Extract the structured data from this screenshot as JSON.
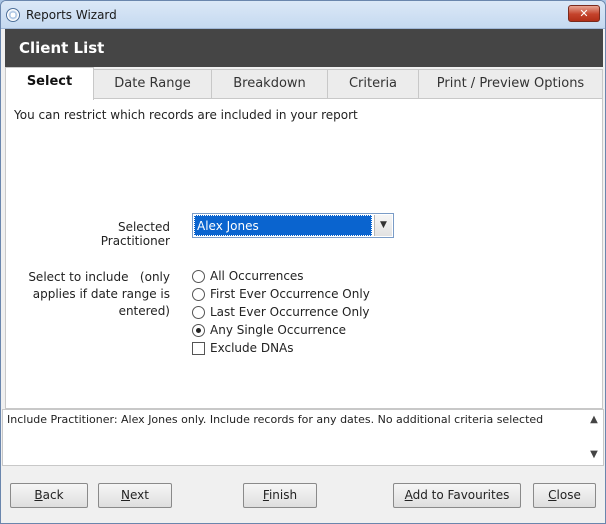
{
  "window": {
    "title": "Reports Wizard",
    "close_label": "✕"
  },
  "header": {
    "title": "Client List"
  },
  "tabs": [
    {
      "label": "Select",
      "active": true
    },
    {
      "label": "Date Range",
      "active": false
    },
    {
      "label": "Breakdown",
      "active": false
    },
    {
      "label": "Criteria",
      "active": false
    },
    {
      "label": "Print / Preview Options",
      "active": false
    }
  ],
  "panel": {
    "intro": "You can restrict which records are included in your report",
    "practitioner_label": "Selected Practitioner",
    "practitioner_value": "Alex Jones",
    "include_label_1": "Select to include   (only",
    "include_label_2": "applies if date range is",
    "include_label_3": "entered)",
    "options": [
      {
        "label": "All Occurrences",
        "checked": false
      },
      {
        "label": "First Ever Occurrence Only",
        "checked": false
      },
      {
        "label": "Last Ever Occurrence Only",
        "checked": false
      },
      {
        "label": "Any Single Occurrence",
        "checked": true
      }
    ],
    "exclude_dnas_label": "Exclude DNAs",
    "exclude_dnas_checked": false
  },
  "summary": "Include Practitioner: Alex Jones only. Include records for any dates. No additional criteria selected",
  "buttons": {
    "back_first": "B",
    "back_rest": "ack",
    "next_first": "N",
    "next_rest": "ext",
    "finish_first": "F",
    "finish_rest": "inish",
    "favourites_first": "A",
    "favourites_rest": "dd to Favourites",
    "close_first": "C",
    "close_rest": "lose"
  }
}
